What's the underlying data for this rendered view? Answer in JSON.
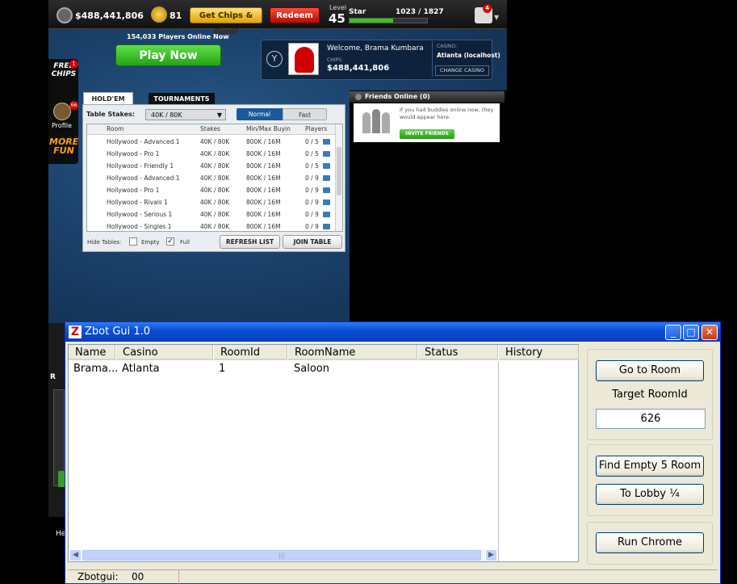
{
  "game": {
    "chips_balance": "$488,441,806",
    "gold_count": "81",
    "get_chips_label": "Get Chips & Gold!",
    "redeem_label": "Redeem",
    "level_label": "Level",
    "level_value": "45",
    "star_label": "Star",
    "xp_text": "1023 / 1827",
    "xp_progress": 0.56,
    "gifts_count": "4",
    "players_online": "154,033 Players Online Now",
    "play_now": "Play Now",
    "welcome": "Welcome, Brama Kumbara",
    "chips_label": "CHIPS:",
    "chips_value": "$488,441,806",
    "casino_label": "CASINO:",
    "casino_value": "Atlanta (localhost)",
    "change_casino": "CHANGE CASINO",
    "side": {
      "free_chips": "FREE CHIPS",
      "free_chips_badge": "1",
      "profile": "Profile",
      "profile_badge": "66",
      "more_fun": "MORE FUN"
    },
    "lobby": {
      "tab_holdem": "HOLD'EM",
      "tab_tournaments": "TOURNAMENTS",
      "stakes_label": "Table Stakes:",
      "stakes_value": "40K / 80K",
      "speed_normal": "Normal",
      "speed_fast": "Fast",
      "columns": [
        "Room",
        "Stakes",
        "Min/Max Buyin",
        "Players"
      ],
      "rows": [
        [
          "Hollywood - Advanced 1",
          "40K / 80K",
          "800K / 16M",
          "0 / 5"
        ],
        [
          "Hollywood - Pro 1",
          "40K / 80K",
          "800K / 16M",
          "0 / 5"
        ],
        [
          "Hollywood - Friendly 1",
          "40K / 80K",
          "800K / 16M",
          "0 / 5"
        ],
        [
          "Hollywood - Advanced 1",
          "40K / 80K",
          "800K / 16M",
          "0 / 9"
        ],
        [
          "Hollywood - Pro 1",
          "40K / 80K",
          "800K / 16M",
          "0 / 9"
        ],
        [
          "Hollywood - Rivals 1",
          "40K / 80K",
          "800K / 16M",
          "0 / 9"
        ],
        [
          "Hollywood - Serious 1",
          "40K / 80K",
          "800K / 16M",
          "0 / 9"
        ],
        [
          "Hollywood - Singles 1",
          "40K / 80K",
          "800K / 16M",
          "0 / 9"
        ]
      ],
      "hide_tables": "Hide Tables:",
      "empty": "Empty",
      "full": "Full",
      "refresh": "REFRESH LIST",
      "join": "JOIN TABLE"
    },
    "friends": {
      "title": "Friends Online (0)",
      "message": "If you had buddies online now, they would appear here.",
      "invite": "INVITE FRIENDS"
    },
    "partial_left_1": "R",
    "partial_left_2": "He"
  },
  "zbot": {
    "title": "Zbot Gui 1.0",
    "columns": [
      "Name",
      "Casino",
      "RoomId",
      "RoomName",
      "Status"
    ],
    "history_header": "History",
    "rows": [
      {
        "name": "Brama...",
        "casino": "Atlanta",
        "roomid": "1",
        "roomname": "Saloon",
        "status": ""
      }
    ],
    "go_to_room": "Go to Room",
    "target_room_label": "Target RoomId",
    "target_room_value": "626",
    "find_empty": "Find Empty 5 Room",
    "to_lobby": "To Lobby ¼",
    "run_chrome": "Run Chrome",
    "status_label": "Zbotgui:",
    "status_value": "00",
    "scroll_grip": "|||"
  },
  "colors": {
    "game_bg": "#1b426c",
    "xp_green": "#3fc12a",
    "xp_bar": "#264226",
    "xp_track": "#333333",
    "tab_active": "#ffffff",
    "xp_title": "#0a4fd6"
  }
}
